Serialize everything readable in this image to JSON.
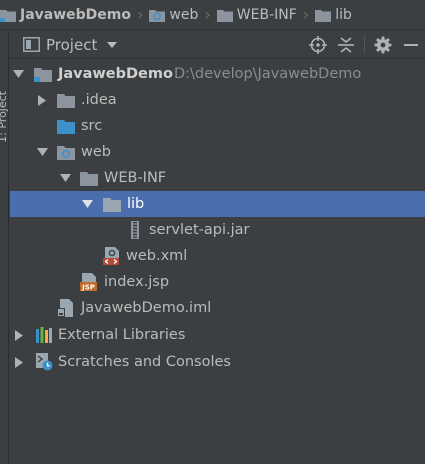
{
  "breadcrumb": {
    "items": [
      {
        "label": "JavawebDemo",
        "icon": "project-folder-icon"
      },
      {
        "label": "web",
        "icon": "web-folder-icon"
      },
      {
        "label": "WEB-INF",
        "icon": "folder-icon"
      },
      {
        "label": "lib",
        "icon": "folder-icon"
      }
    ]
  },
  "toolstripe": {
    "label": "1: Project"
  },
  "panel": {
    "title": "Project",
    "icons": [
      "project-view-icon",
      "dropdown-icon",
      "locate-icon",
      "collapse-icon",
      "settings-icon",
      "hide-icon"
    ]
  },
  "tree": {
    "root": {
      "label": "JavawebDemo",
      "path": "D:\\develop\\JavawebDemo"
    },
    "idea": {
      "label": ".idea"
    },
    "src": {
      "label": "src"
    },
    "web": {
      "label": "web"
    },
    "webinf": {
      "label": "WEB-INF"
    },
    "lib": {
      "label": "lib"
    },
    "servlet": {
      "label": "servlet-api.jar"
    },
    "webxml": {
      "label": "web.xml"
    },
    "indexjsp": {
      "label": "index.jsp"
    },
    "iml": {
      "label": "JavawebDemo.iml"
    },
    "extlib": {
      "label": "External Libraries"
    },
    "scratches": {
      "label": "Scratches and Consoles"
    }
  },
  "colors": {
    "background": "#3c3f41",
    "selection": "#4b6eaf",
    "text": "#bbbbbb",
    "folder": "#8c959e",
    "source_folder": "#3d91c9"
  }
}
